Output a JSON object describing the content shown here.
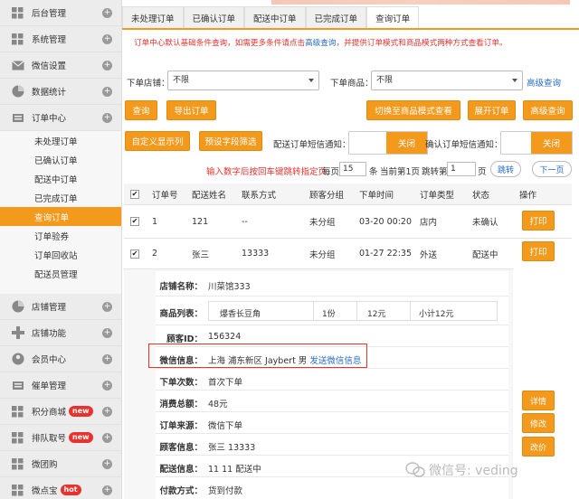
{
  "sidebar": {
    "groups": [
      {
        "label": "后台管理",
        "icon": "grid-icon"
      },
      {
        "label": "系统管理",
        "icon": "grid-icon"
      },
      {
        "label": "微信设置",
        "icon": "envelope-icon"
      },
      {
        "label": "数据统计",
        "icon": "pie-icon"
      },
      {
        "label": "订单中心",
        "icon": "cart-icon"
      }
    ],
    "order_items": [
      "未处理订单",
      "已确认订单",
      "配送中订单",
      "已完成订单",
      "查询订单",
      "订单验券",
      "订单回收站",
      "配送员管理"
    ],
    "groups2": [
      {
        "label": "店铺管理",
        "icon": "pie-icon"
      },
      {
        "label": "店铺功能",
        "icon": "plus-cross-icon"
      },
      {
        "label": "会员中心",
        "icon": "user-icon"
      },
      {
        "label": "催单管理",
        "icon": "cart-icon"
      },
      {
        "label": "积分商城",
        "icon": "grid-icon",
        "badge": "new"
      },
      {
        "label": "排队取号",
        "icon": "grid-icon",
        "badge": "new"
      },
      {
        "label": "微团购",
        "icon": "grid-icon"
      },
      {
        "label": "微点宝",
        "icon": "grid-icon",
        "badge": "hot"
      }
    ]
  },
  "tabs": [
    "未处理订单",
    "已确认订单",
    "配送中订单",
    "已完成订单",
    "查询订单"
  ],
  "notice": {
    "text1": "订单中心默认基础条件查询，如需更多条件请点击",
    "link": "高级查询",
    "text2": "，并提供订单模式和商品模式两种方式查看订单。"
  },
  "filters": {
    "shop_label": "下单店铺：",
    "shop_value": "不限",
    "product_label": "下单商品：",
    "product_value": "不限",
    "advanced": "高级查询"
  },
  "buttons": {
    "query": "查询",
    "export": "导出订单",
    "switch_mode": "切换至商品模式查看",
    "expand": "展开订单",
    "advanced": "高级查询",
    "custom_columns": "自定义显示列",
    "preset_filter": "预设字段筛选"
  },
  "sms": {
    "delivery_label": "配送订单短信通知：",
    "delivery_value": "关闭",
    "confirm_label": "确认订单短信通知：",
    "confirm_value": "关闭"
  },
  "pager": {
    "hint": "输入数字后按回车键跳转指定页",
    "per_page_label": "每页",
    "per_page": "15",
    "per_page_unit": "条",
    "current": "当前第1页",
    "jump_label": "跳转第",
    "jump_value": "1",
    "jump_unit": "页",
    "jump_btn": "跳转",
    "next": "下一页"
  },
  "table": {
    "headers": [
      "订单号",
      "配送姓名",
      "联系方式",
      "顾客分组",
      "下单时间",
      "订单类型",
      "状态",
      "操作"
    ],
    "rows": [
      {
        "id": "1",
        "name": "121",
        "contact": "--",
        "group": "未分组",
        "time": "03-20 00:20",
        "type": "店内",
        "status": "未确认",
        "action": "打印"
      },
      {
        "id": "2",
        "name": "张三",
        "contact": "13333",
        "group": "未分组",
        "time": "01-27 22:35",
        "type": "外送",
        "status": "配送中",
        "action": "打印"
      }
    ]
  },
  "detail": {
    "shop_label": "店铺名称：",
    "shop_value": "川菜馆333",
    "list_label": "商品列表：",
    "item_name": "爆香长豆角",
    "item_qty": "1份",
    "item_price": "12元",
    "item_subtotal": "小计12元",
    "cust_id_label": "顾客ID：",
    "cust_id": "156324",
    "wechat_label": "微信信息：",
    "wechat_value": "上海 浦东新区 Jaybert 男",
    "wechat_link": "发送微信信息",
    "count_label": "下单次数：",
    "count_value": "首次下单",
    "total_label": "消费总额：",
    "total_value": "48元",
    "source_label": "订单来源：",
    "source_value": "微信下单",
    "custinfo_label": "顾客信息：",
    "custinfo_value": "张三   13333",
    "delivery_label": "配送信息：",
    "delivery_value": "11 11 配送中",
    "pay_label": "付款方式：",
    "pay_value": "货到付款"
  },
  "side_actions": [
    "详情",
    "修改",
    "改价"
  ],
  "watermark": "微信号: veding",
  "colors": {
    "accent": "#f39a1c",
    "link": "#2a6cc7",
    "alert": "#e8322d"
  }
}
